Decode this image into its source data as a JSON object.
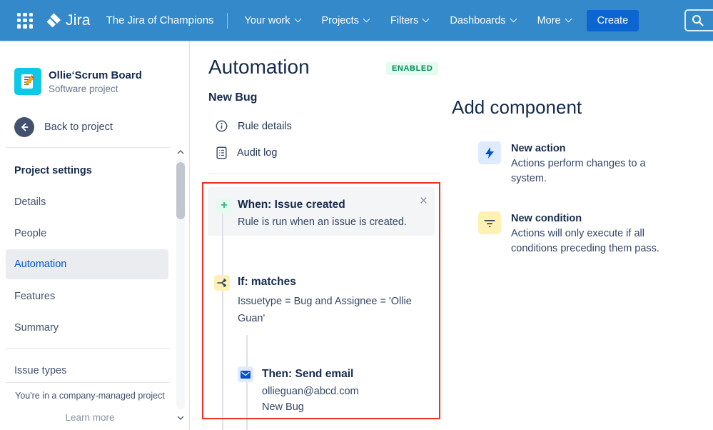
{
  "navbar": {
    "logo_text": "Jira",
    "site_label": "The Jira of Champions",
    "items": [
      {
        "label": "Your work"
      },
      {
        "label": "Projects"
      },
      {
        "label": "Filters"
      },
      {
        "label": "Dashboards"
      },
      {
        "label": "More"
      }
    ],
    "create_label": "Create"
  },
  "sidebar": {
    "project": {
      "name": "Ollie‘Scrum Board",
      "type": "Software project"
    },
    "back_label": "Back to project",
    "section_title": "Project settings",
    "items": [
      {
        "label": "Details",
        "selected": false
      },
      {
        "label": "People",
        "selected": false
      },
      {
        "label": "Automation",
        "selected": true
      },
      {
        "label": "Features",
        "selected": false
      },
      {
        "label": "Summary",
        "selected": false
      }
    ],
    "issue_types_label": "Issue types",
    "footer_note": "You're in a company-managed project",
    "learn_more_label": "Learn more"
  },
  "main": {
    "title": "Automation",
    "status_badge": "ENABLED",
    "rule_name": "New Bug",
    "links": [
      {
        "label": "Rule details"
      },
      {
        "label": "Audit log"
      }
    ],
    "rule": {
      "trigger": {
        "title": "When: Issue created",
        "subtitle": "Rule is run when an issue is created."
      },
      "condition": {
        "title": "If: matches",
        "subtitle": "Issuetype = Bug and Assignee = 'Ollie Guan'"
      },
      "action": {
        "title": "Then: Send email",
        "recipient": "ollieguan@abcd.com",
        "subject": "New Bug"
      }
    },
    "add_component": {
      "title": "Add component",
      "items": [
        {
          "title": "New action",
          "desc": "Actions perform changes to a system."
        },
        {
          "title": "New condition",
          "desc": "Actions will only execute if all conditions preceding them pass."
        }
      ]
    }
  },
  "icons": {
    "plus": "+",
    "close": "×",
    "app_switcher": "grid-of-dots",
    "search": "magnifier",
    "trigger": "plus",
    "condition_branch": "fork-arrows",
    "action_email": "envelope",
    "new_action": "lightning-bolt",
    "new_condition": "filter-lines",
    "rule_details": "info-circle",
    "audit_log": "document-lines"
  },
  "colors": {
    "nav_bg": "#3389CA",
    "create_bg": "#0C66D2",
    "accent_blue": "#0052CC",
    "text_primary": "#172B4D",
    "badge_bg": "#E3FCEF",
    "badge_text": "#00875A",
    "highlight_red": "#EE3124",
    "icon_yellow_bg": "#FFF0B3",
    "icon_blue_bg": "#DEEBFF",
    "icon_green_bg": "#E3FCEF",
    "avatar_cyan": "#0EC8E8",
    "selected_item_bg": "#EBECF0"
  }
}
